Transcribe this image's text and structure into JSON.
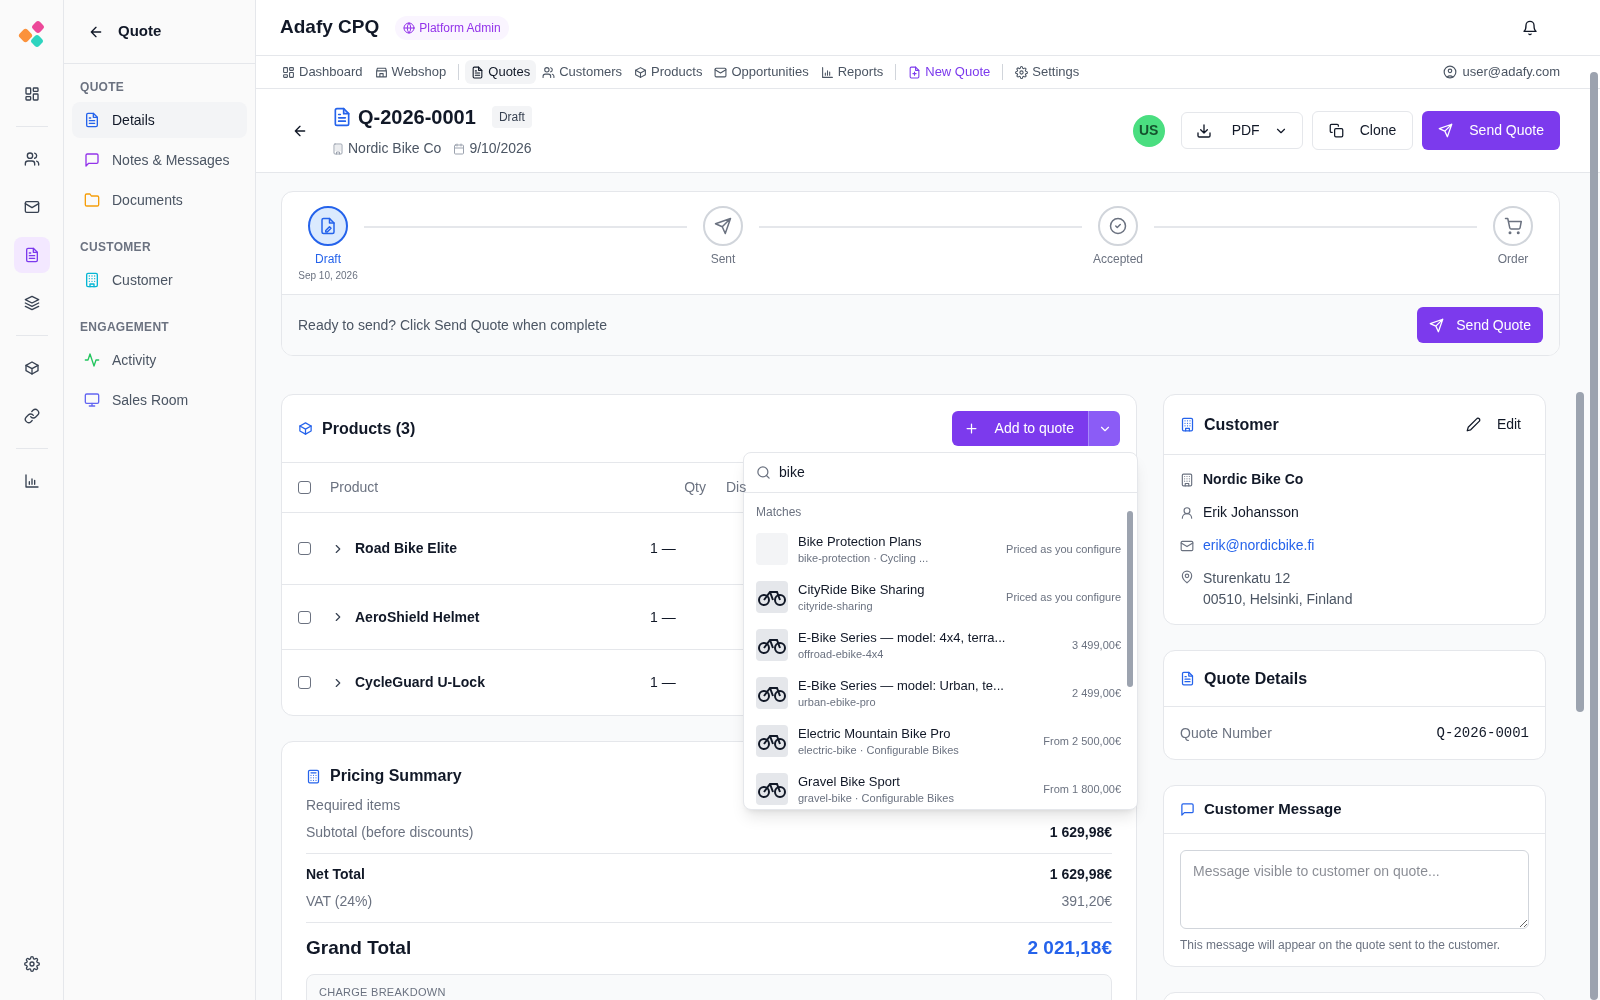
{
  "rail": {
    "groups": [
      [
        {
          "selected": false
        }
      ],
      [
        {
          "selected": false
        },
        {
          "selected": false
        },
        {
          "selected": true
        },
        {
          "selected": false
        }
      ],
      [
        {
          "selected": false
        },
        {
          "selected": false
        }
      ],
      [
        {
          "selected": false
        }
      ]
    ],
    "footer": [
      {
        "selected": false
      }
    ]
  },
  "sidenav": {
    "title": "Quote",
    "sections": [
      {
        "heading": "QUOTE",
        "items": [
          {
            "label": "Details",
            "selected": true
          },
          {
            "label": "Notes & Messages",
            "selected": false
          },
          {
            "label": "Documents",
            "selected": false
          }
        ]
      },
      {
        "heading": "CUSTOMER",
        "items": [
          {
            "label": "Customer",
            "selected": false
          }
        ]
      },
      {
        "heading": "ENGAGEMENT",
        "items": [
          {
            "label": "Activity",
            "selected": false
          },
          {
            "label": "Sales Room",
            "selected": false
          }
        ]
      }
    ]
  },
  "header": {
    "title": "Adafy CPQ",
    "role_badge": "Platform Admin"
  },
  "topnav": {
    "groups": [
      [
        {
          "label": "Dashboard",
          "kind": "link",
          "selected": false
        },
        {
          "label": "Webshop",
          "kind": "link",
          "selected": false
        }
      ],
      [
        {
          "label": "Quotes",
          "kind": "link",
          "selected": true
        },
        {
          "label": "Customers",
          "kind": "link",
          "selected": false
        },
        {
          "label": "Products",
          "kind": "link",
          "selected": false
        },
        {
          "label": "Opportunities",
          "kind": "link",
          "selected": false
        },
        {
          "label": "Reports",
          "kind": "link",
          "selected": false
        }
      ],
      [
        {
          "label": "New Quote",
          "kind": "action",
          "selected": false
        }
      ],
      [
        {
          "label": "Settings",
          "kind": "link",
          "selected": false
        }
      ]
    ],
    "user": "user@adafy.com"
  },
  "quote": {
    "number": "Q-2026-0001",
    "status": "Draft",
    "customer": "Nordic Bike Co",
    "date": "9/10/2026",
    "avatar": "US",
    "buttons": [
      {
        "label": "PDF",
        "kind": "menu"
      },
      {
        "label": "Clone",
        "kind": "secondary"
      },
      {
        "label": "Send Quote",
        "kind": "primary"
      }
    ]
  },
  "stepper": {
    "steps": [
      {
        "label": "Draft",
        "date": "Sep 10, 2026",
        "current": true
      },
      {
        "label": "Sent",
        "current": false
      },
      {
        "label": "Accepted",
        "current": false
      },
      {
        "label": "Order",
        "current": false
      }
    ],
    "message": "Ready to send? Click Send Quote when complete",
    "button": "Send Quote"
  },
  "products": {
    "title": "Products (3)",
    "add_button": "Add to quote",
    "header_checked": false,
    "columns": [
      "Product",
      "Qty",
      "Dis"
    ],
    "rows": [
      {
        "name": "Road Bike Elite",
        "qty": "1 —",
        "checked": false,
        "expanded": false
      },
      {
        "name": "AeroShield Helmet",
        "qty": "1 —",
        "checked": false,
        "expanded": false
      },
      {
        "name": "CycleGuard U-Lock",
        "qty": "1 —",
        "checked": false,
        "expanded": false
      }
    ]
  },
  "product_search": {
    "value": "bike",
    "section": "Matches",
    "results": [
      {
        "name": "Bike Protection Plans",
        "sub": "bike-protection · Cycling ...",
        "price": "Priced as you configure",
        "kind": "blank"
      },
      {
        "name": "CityRide Bike Sharing",
        "sub": "cityride-sharing",
        "price": "Priced as you configure",
        "kind": "photo"
      },
      {
        "name": "E-Bike Series — model: 4x4, terra...",
        "sub": "offroad-ebike-4x4",
        "price": "3 499,00€",
        "kind": "photo"
      },
      {
        "name": "E-Bike Series — model: Urban, te...",
        "sub": "urban-ebike-pro",
        "price": "2 499,00€",
        "kind": "photo"
      },
      {
        "name": "Electric Mountain Bike Pro",
        "sub": "electric-bike · Configurable Bikes",
        "price": "From 2 500,00€",
        "kind": "photo"
      },
      {
        "name": "Gravel Bike Sport",
        "sub": "gravel-bike · Configurable Bikes",
        "price": "From 1 800,00€",
        "kind": "photo"
      }
    ]
  },
  "pricing": {
    "title": "Pricing Summary",
    "groups": [
      [
        {
          "label": "Required items",
          "kind": "line"
        },
        {
          "label": "Subtotal (before discounts)",
          "value": "1 629,98€",
          "kind": "line"
        }
      ],
      [
        {
          "label": "Net Total",
          "value": "1 629,98€",
          "kind": "total"
        },
        {
          "label": "VAT (24%)",
          "value": "391,20€",
          "kind": "tax"
        }
      ],
      [
        {
          "label": "Grand Total",
          "value": "2 021,18€",
          "kind": "grand"
        }
      ]
    ],
    "breakdown_heading": "CHARGE BREAKDOWN"
  },
  "customer": {
    "title": "Customer",
    "edit": "Edit",
    "company": "Nordic Bike Co",
    "contact": "Erik Johansson",
    "email": "erik@nordicbike.fi",
    "address": [
      "Sturenkatu 12",
      "00510, Helsinki, Finland"
    ]
  },
  "quote_details": {
    "title": "Quote Details",
    "label": "Quote Number",
    "value": "Q-2026-0001"
  },
  "customer_message": {
    "title": "Customer Message",
    "placeholder": "Message visible to customer on quote...",
    "help": "This message will appear on the quote sent to the customer."
  }
}
